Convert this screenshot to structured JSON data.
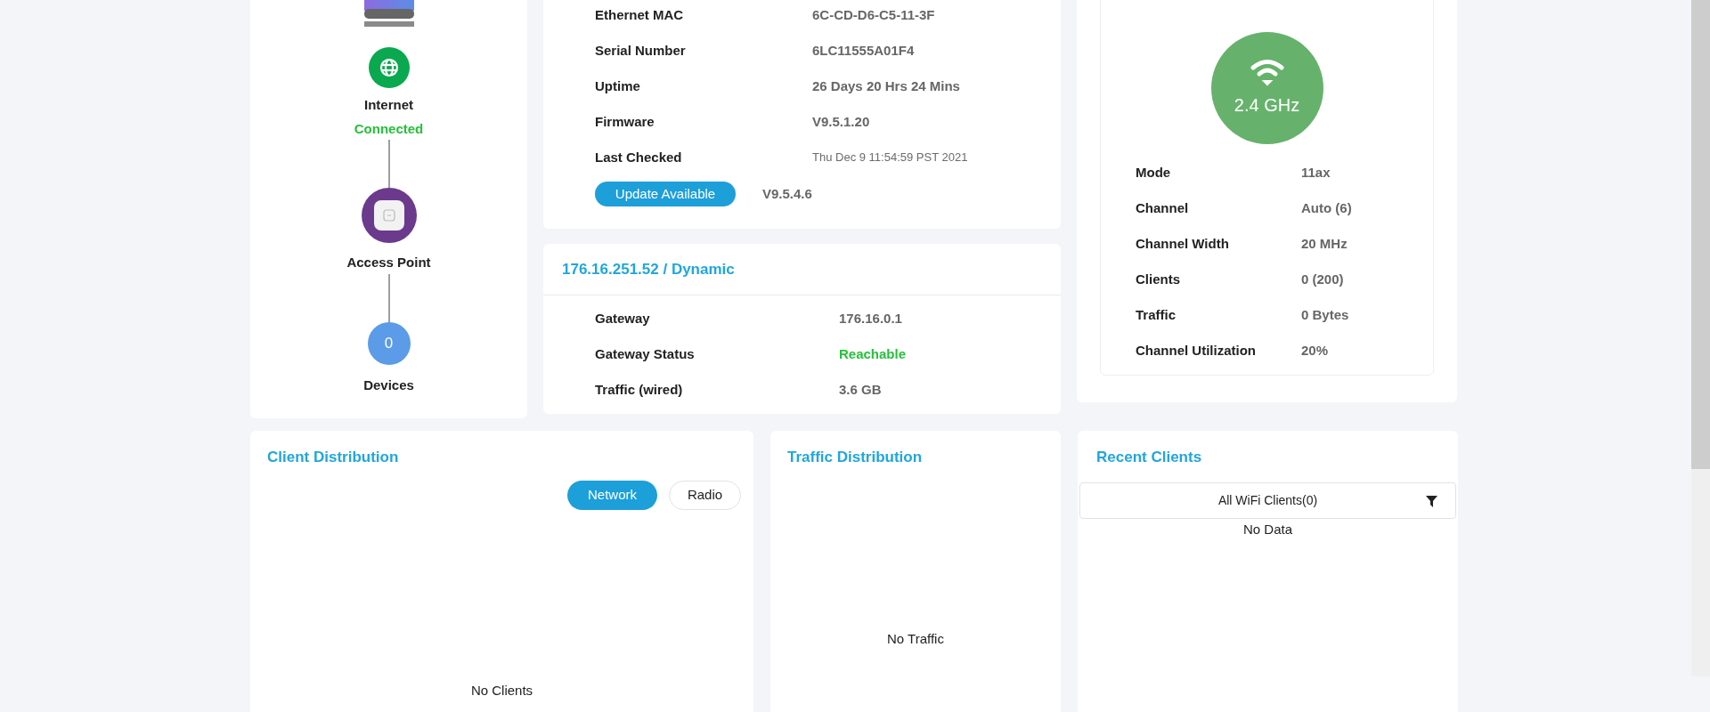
{
  "topology": {
    "nodes": [
      {
        "kind": "internet",
        "label": "Internet",
        "status": "Connected"
      },
      {
        "kind": "access_point",
        "label": "Access Point"
      },
      {
        "kind": "devices",
        "count": "0",
        "label": "Devices"
      }
    ]
  },
  "device_info": {
    "rows": [
      {
        "label": "Ethernet MAC",
        "value": "6C-CD-D6-C5-11-3F",
        "kind": "text"
      },
      {
        "label": "Serial Number",
        "value": "6LC11555A01F4",
        "kind": "text"
      },
      {
        "label": "Uptime",
        "value": "26 Days 20 Hrs 24 Mins",
        "kind": "text"
      },
      {
        "label": "Firmware",
        "value": "V9.5.1.20",
        "kind": "text"
      },
      {
        "label": "Last Checked",
        "value": "Thu Dec 9 11:54:59 PST 2021",
        "kind": "small"
      }
    ],
    "update_button": "Update Available",
    "available_version": "V9.5.4.6"
  },
  "ip_card": {
    "title": "176.16.251.52 / Dynamic",
    "rows": [
      {
        "label": "Gateway",
        "value": "176.16.0.1",
        "kind": "text"
      },
      {
        "label": "Gateway Status",
        "value": "Reachable",
        "kind": "status"
      },
      {
        "label": "Traffic (wired)",
        "value": "3.6 GB",
        "kind": "text"
      }
    ]
  },
  "radio": {
    "band": "2.4 GHz",
    "rows": [
      {
        "label": "Mode",
        "value": "11ax"
      },
      {
        "label": "Channel",
        "value": "Auto (6)"
      },
      {
        "label": "Channel Width",
        "value": "20 MHz"
      },
      {
        "label": "Clients",
        "value": "0 (200)"
      },
      {
        "label": "Traffic",
        "value": "0 Bytes"
      },
      {
        "label": "Channel Utilization",
        "value": "20%"
      }
    ]
  },
  "client_distribution": {
    "title": "Client Distribution",
    "toggle": [
      {
        "label": "Network",
        "selected": true
      },
      {
        "label": "Radio",
        "selected": false
      }
    ],
    "empty_text": "No Clients"
  },
  "traffic_distribution": {
    "title": "Traffic Distribution",
    "empty_text": "No Traffic"
  },
  "recent_clients": {
    "title": "Recent Clients",
    "filter_label": "All WiFi Clients(0)",
    "empty_text": "No Data"
  }
}
